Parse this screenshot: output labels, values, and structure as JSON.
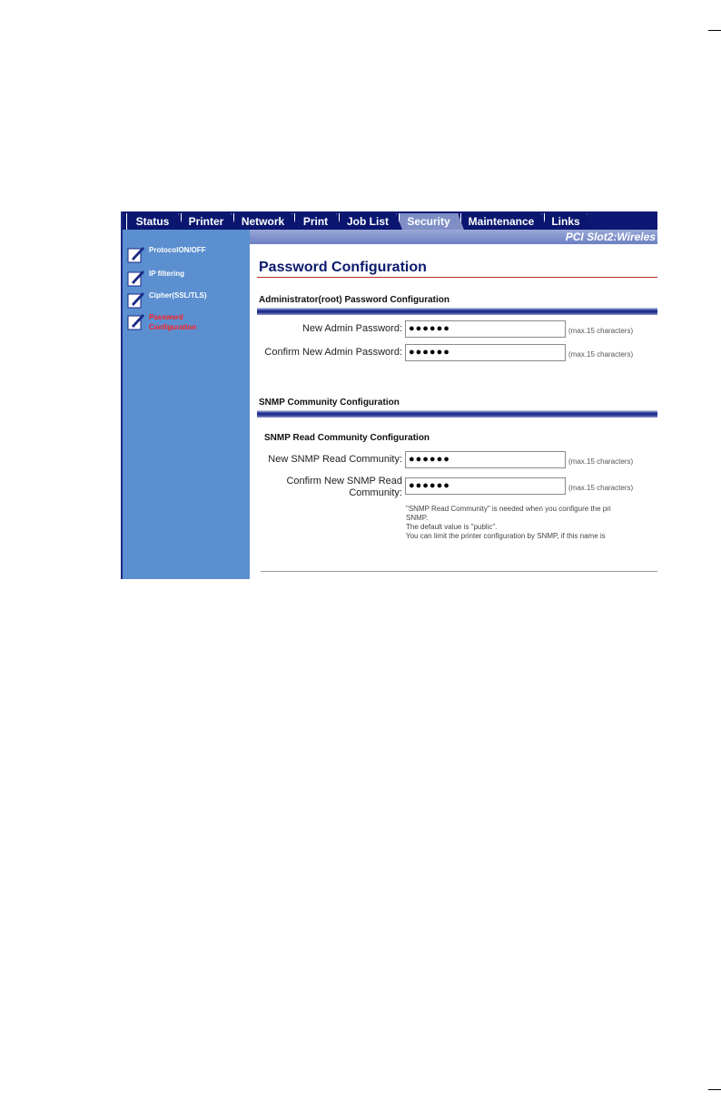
{
  "tabs": [
    {
      "label": "Status"
    },
    {
      "label": "Printer"
    },
    {
      "label": "Network"
    },
    {
      "label": "Print"
    },
    {
      "label": "Job List"
    },
    {
      "label": "Security"
    },
    {
      "label": "Maintenance"
    },
    {
      "label": "Links"
    }
  ],
  "active_tab": "Security",
  "slot_name": "PCI Slot2:Wireles",
  "sidebar": {
    "items": [
      {
        "label": "ProtocolON/OFF",
        "active": false
      },
      {
        "label": "IP filtering",
        "active": false
      },
      {
        "label": "Cipher(SSL/TLS)",
        "active": false
      },
      {
        "label": "Password Configuration",
        "active": true
      }
    ]
  },
  "page_title": "Password Configuration",
  "admin_section": {
    "title": "Administrator(root) Password Configuration",
    "new_label": "New Admin Password:",
    "new_value": "●●●●●●",
    "confirm_label": "Confirm New Admin Password:",
    "confirm_value": "●●●●●●",
    "hint": "(max.15 characters)"
  },
  "snmp_section": {
    "title": "SNMP Community Configuration",
    "sub_title": "SNMP Read Community Configuration",
    "new_label": "New SNMP Read Community:",
    "new_value": "●●●●●●",
    "confirm_label_line1": "Confirm New SNMP Read",
    "confirm_label_line2": "Community:",
    "confirm_value": "●●●●●●",
    "hint": "(max.15 characters)",
    "note_line1": "\"SNMP Read Community\" is needed when you configure the pri",
    "note_line2": "SNMP.",
    "note_line3": "The default value is \"public\".",
    "note_line4": "You can limit the printer configuration by SNMP, if this name is"
  },
  "colors": {
    "tab_bg": "#0a1670",
    "tab_active": "#7f8fc6",
    "sidebar_bg": "#5b8fd0",
    "title_color": "#0c1a6e",
    "active_link": "#ff2020"
  }
}
